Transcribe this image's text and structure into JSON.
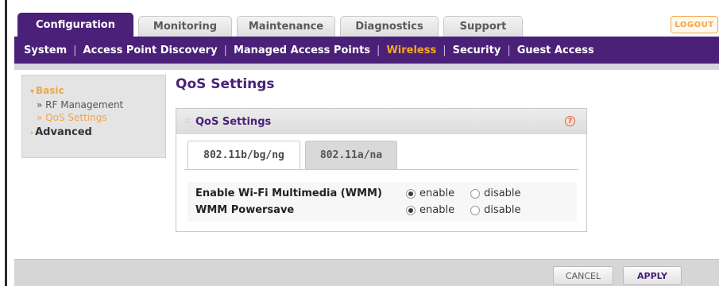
{
  "tabs": [
    {
      "label": "Configuration",
      "active": true
    },
    {
      "label": "Monitoring",
      "active": false
    },
    {
      "label": "Maintenance",
      "active": false
    },
    {
      "label": "Diagnostics",
      "active": false
    },
    {
      "label": "Support",
      "active": false
    }
  ],
  "logout_label": "LOGOUT",
  "subnav": [
    {
      "label": "System",
      "active": false
    },
    {
      "label": "Access Point Discovery",
      "active": false
    },
    {
      "label": "Managed Access Points",
      "active": false
    },
    {
      "label": "Wireless",
      "active": true
    },
    {
      "label": "Security",
      "active": false
    },
    {
      "label": "Guest Access",
      "active": false
    }
  ],
  "leftmenu": {
    "basic": "Basic",
    "items": [
      "» RF Management",
      "» QoS Settings"
    ],
    "advanced": "Advanced"
  },
  "page_title": "QoS Settings",
  "panel": {
    "title": "QoS Settings",
    "help": "?",
    "subtabs": [
      "802.11b/bg/ng",
      "802.11a/na"
    ],
    "rows": [
      {
        "label": "Enable Wi-Fi Multimedia (WMM)",
        "enable": "enable",
        "disable": "disable",
        "selected": "enable"
      },
      {
        "label": "WMM Powersave",
        "enable": "enable",
        "disable": "disable",
        "selected": "enable"
      }
    ]
  },
  "footer": {
    "cancel": "CANCEL",
    "apply": "APPLY"
  },
  "colors": {
    "brand_purple": "#4b2079",
    "accent_orange": "#f0a64a",
    "active_subnav": "#f7a823"
  }
}
